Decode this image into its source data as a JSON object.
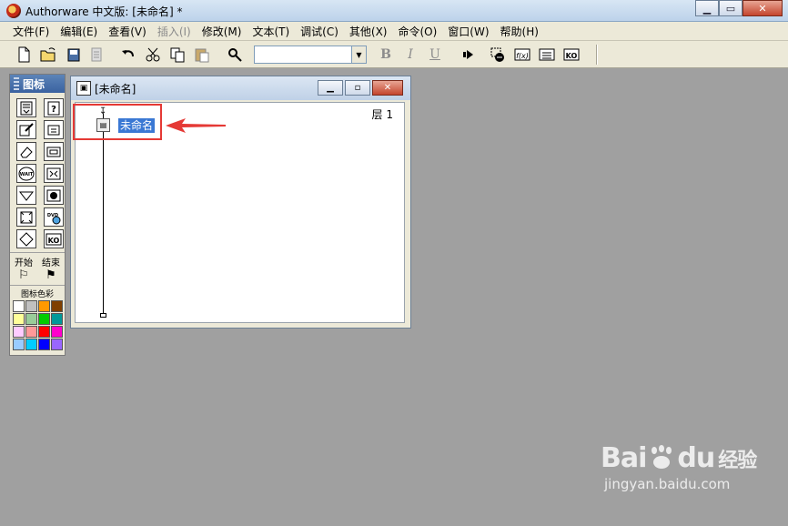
{
  "window": {
    "title": "Authorware 中文版: [未命名] *",
    "icons": {
      "logo": "authorware-logo-icon",
      "minimize": "minimize-icon",
      "maximize": "maximize-icon",
      "close": "close-icon"
    }
  },
  "menubar": {
    "items": [
      {
        "label": "文件(F)",
        "enabled": true
      },
      {
        "label": "编辑(E)",
        "enabled": true
      },
      {
        "label": "查看(V)",
        "enabled": true
      },
      {
        "label": "插入(I)",
        "enabled": false
      },
      {
        "label": "修改(M)",
        "enabled": true
      },
      {
        "label": "文本(T)",
        "enabled": true
      },
      {
        "label": "调试(C)",
        "enabled": true
      },
      {
        "label": "其他(X)",
        "enabled": true
      },
      {
        "label": "命令(O)",
        "enabled": true
      },
      {
        "label": "窗口(W)",
        "enabled": true
      },
      {
        "label": "帮助(H)",
        "enabled": true
      }
    ]
  },
  "toolbar": {
    "font_value": "",
    "bold": "B",
    "italic": "I",
    "underline": "U",
    "icons": [
      "new-file-icon",
      "open-folder-icon",
      "save-all-icon",
      "import-icon",
      "undo-icon",
      "cut-icon",
      "copy-icon",
      "paste-icon",
      "find-icon",
      "run-icon",
      "control-panel-icon",
      "functions-icon",
      "variables-icon",
      "knowledge-objects-icon"
    ]
  },
  "palette": {
    "title": "图标",
    "start_label": "开始",
    "end_label": "结束",
    "color_label": "图标色彩",
    "icons": [
      "display-icon",
      "interaction-icon",
      "motion-icon",
      "calculation-icon",
      "erase-icon",
      "map-icon",
      "wait-icon",
      "digital-movie-icon",
      "navigate-icon",
      "sound-icon",
      "decision-icon",
      "video-icon",
      "framework-icon",
      "knowledge-object-icon"
    ],
    "wait_text": "WAIT",
    "dvd_text": "DVD",
    "ko_text": "KO",
    "colors": [
      "#ffffff",
      "#c0c0c0",
      "#ff9900",
      "#7f3f00",
      "#ffff99",
      "#99cc99",
      "#00cc00",
      "#009999",
      "#ffccff",
      "#ff9999",
      "#ff0000",
      "#ff00cc",
      "#99ccff",
      "#00ccff",
      "#0000ff",
      "#9966ff"
    ]
  },
  "flow_window": {
    "title": "[未命名]",
    "layer_label": "层 1",
    "node_label": "未命名"
  },
  "watermark": {
    "brand": "Bai",
    "brand_suffix": "du",
    "brand_cn": "经验",
    "url": "jingyan.baidu.com"
  }
}
